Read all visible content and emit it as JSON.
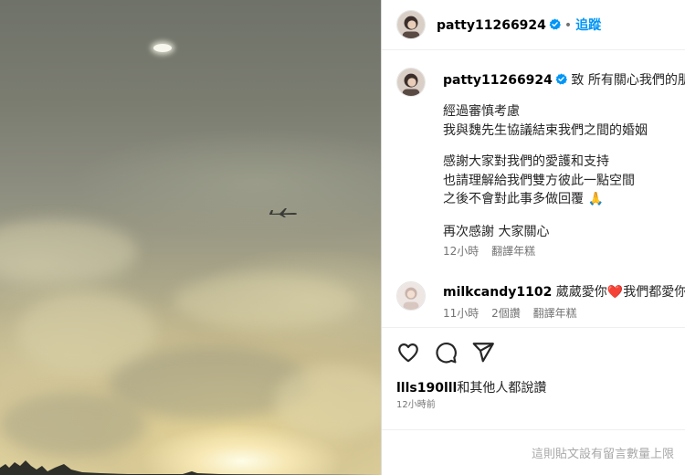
{
  "post": {
    "author": "patty11266924",
    "follow_label": "追蹤",
    "dot": "•",
    "caption": {
      "author": "patty11266924",
      "lines": [
        "致 所有關心我們的朋友",
        "經過審慎考慮",
        "我與魏先生協議結束我們之間的婚姻",
        "感謝大家對我們的愛護和支持",
        "也請理解給我們雙方彼此一點空間",
        "之後不會對此事多做回覆 🙏",
        "再次感謝 大家關心"
      ],
      "time": "12小時",
      "translate_label": "翻譯年糕"
    },
    "comment": {
      "author": "milkcandy1102",
      "text_before_heart": "葳葳愛你",
      "heart": "❤️",
      "text_after_heart": "我們都愛你",
      "time": "11小時",
      "likes": "2個讚",
      "translate_label": "翻譯年糕"
    },
    "actions": {
      "like_icon": "heart-outline-icon",
      "comment_icon": "speech-bubble-icon",
      "share_icon": "paper-plane-icon"
    },
    "likes_line": {
      "user": "llls190lll",
      "rest": "和其他人都說讚"
    },
    "timestamp": "12小時前",
    "comments_limited_text": "這則貼文設有留言數量上限"
  },
  "colors": {
    "link_blue": "#0095f6",
    "verified_blue": "#0095f6",
    "secondary_text": "#737373",
    "footer_text": "#a8a8a8",
    "divider": "#efefef"
  }
}
